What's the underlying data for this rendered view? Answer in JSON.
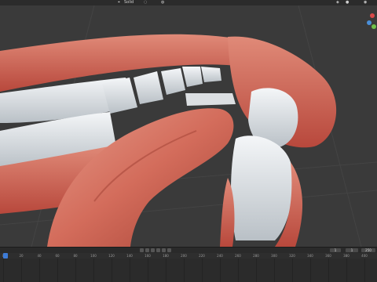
{
  "header": {
    "view_label": "Solid",
    "menu_icon": "view-menu-icon",
    "overlay_icon": "overlay-icon",
    "shading_icon": "shading-icon"
  },
  "viewport": {
    "object": "mouth-model",
    "colors": {
      "background": "#3a3a3a",
      "gum": "#d9705e",
      "tongue": "#d57c69",
      "teeth": "#e9ecee"
    }
  },
  "gizmo": {
    "icon": "axis-gizmo-icon"
  },
  "timeline": {
    "current_frame": "1",
    "start_frame": "1",
    "end_frame": "250",
    "ruler_ticks": [
      "0",
      "20",
      "40",
      "60",
      "80",
      "100",
      "120",
      "140",
      "160",
      "180",
      "200",
      "220",
      "240",
      "260",
      "280",
      "300",
      "320",
      "340",
      "360",
      "380",
      "400"
    ]
  }
}
